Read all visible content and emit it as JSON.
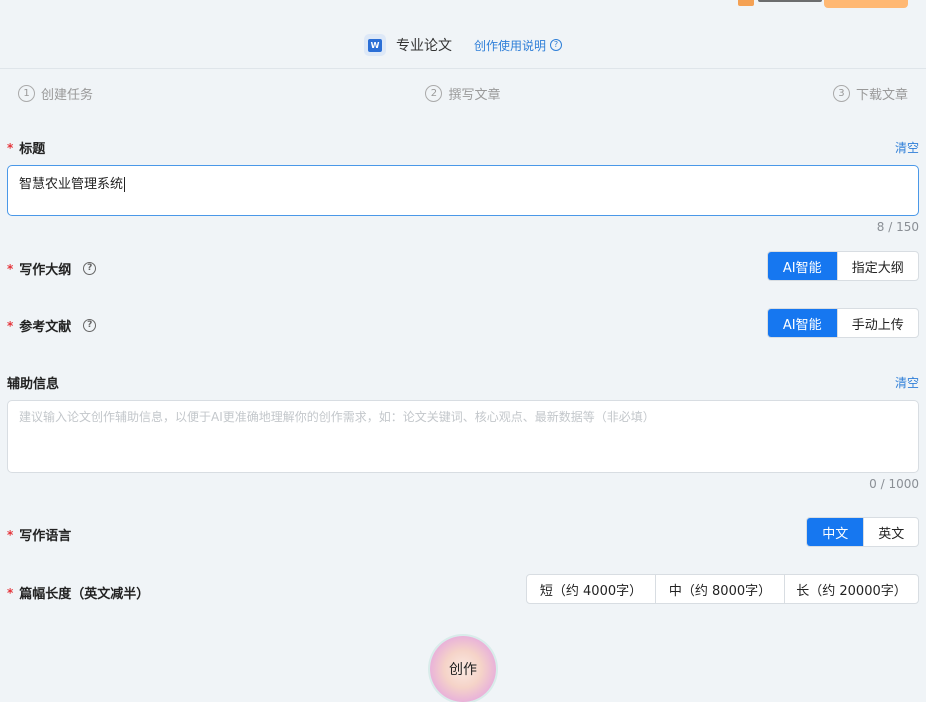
{
  "header": {
    "title": "专业论文",
    "help_link": "创作使用说明",
    "icon": "word-doc-icon"
  },
  "steps": [
    {
      "num": "1",
      "label": "创建任务"
    },
    {
      "num": "2",
      "label": "撰写文章"
    },
    {
      "num": "3",
      "label": "下载文章"
    }
  ],
  "title_field": {
    "label": "标题",
    "clear": "清空",
    "value": "智慧农业管理系统",
    "counter": "8 / 150"
  },
  "outline": {
    "label": "写作大纲",
    "options": [
      "AI智能",
      "指定大纲"
    ],
    "selected": "AI智能"
  },
  "references": {
    "label": "参考文献",
    "options": [
      "AI智能",
      "手动上传"
    ],
    "selected": "AI智能"
  },
  "aux_info": {
    "label": "辅助信息",
    "clear": "清空",
    "placeholder": "建议输入论文创作辅助信息，以便于AI更准确地理解你的创作需求，如：论文关键词、核心观点、最新数据等（非必填）",
    "counter": "0 / 1000"
  },
  "language": {
    "label": "写作语言",
    "options": [
      "中文",
      "英文"
    ],
    "selected": "中文"
  },
  "length": {
    "label": "篇幅长度（英文减半）",
    "options": [
      "短（约 4000字）",
      "中（约 8000字）",
      "长（约 20000字）"
    ]
  },
  "create_button": "创作",
  "colors": {
    "accent": "#1677f0",
    "link": "#2f7fd8",
    "required": "#e5343a"
  }
}
